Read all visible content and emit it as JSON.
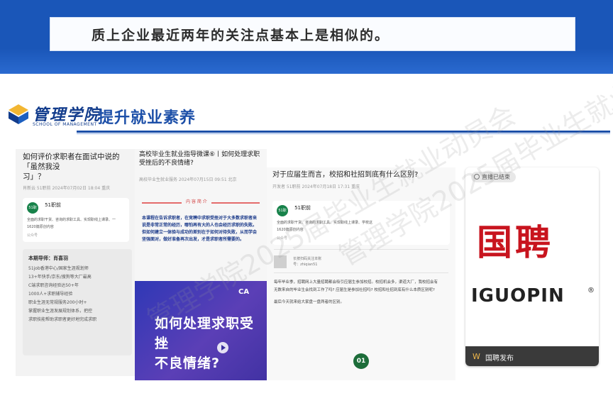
{
  "top_slide": {
    "caption": "质上企业最近两年的关注点基本上是相似的。"
  },
  "header": {
    "logo_text": "管理学院",
    "logo_sub": "SCHOOL OF MANAGEMENT",
    "title": "提升就业素养"
  },
  "panel1": {
    "title": "如何评价求职者在面试中说的「虽然我没",
    "title_cont": "习」？",
    "meta": "肖新云  51职前  2024年07月02日 18:04  重庆",
    "card_name": "51职前",
    "card_desc1": "全面的求职干货、咨询的求职工具、实现职线上课录、一",
    "card_desc2": "1620篇原创内容",
    "card_foot": "公众号",
    "intro_title": "本期导师：肖喜羽",
    "intro_lines": [
      "51job香港中心/国家生涯规划师",
      "13+年快手/京东/搜狗等大厂最高",
      "C端求职咨询经验达50+年",
      "1000人+求职辅导经验",
      "职业生涯无常规服务200小时+",
      "掌握职业生涯发展规划体系，把控",
      "求职技能帮助求职者更好地完成求职"
    ]
  },
  "panel2": {
    "title": "高校毕业生就业指导微课⑥丨如何处理求职受挫后的不良情绪?",
    "meta": "高校毕业生就业服务  2024年07月15日 09:51  北京",
    "promo_label": "内 容 简 介",
    "promo_text": "本课程在告诉求职者，在竞聘中求职受挫对于大多数求职者来说是非常正常的经历，哪怕再有大的人也会经历求职的失败。但如何建立一体验与成功的差别在于如何对待失败，从而学会坚强面对，做好准备再次出发，才是求职者所需要的。",
    "promo_caption_1": "如何处理求职受挫",
    "promo_caption_2": "不良情绪?",
    "promo_logo": "CA"
  },
  "panel3": {
    "title": "对于应届生而言，校招和社招到底有什么区别?",
    "meta": "开发者  51职前  2024年07月18日 17:31  重庆",
    "card_name": "51职前",
    "card_desc1": "全面的求职干货、咨询的求职工具、实现职线上课录、学校这",
    "card_desc2": "1620篇原创内容",
    "card_foot": "公众号",
    "qr_text_1": "长按扫码关注本账",
    "qr_text_2": "号：zhiqian51",
    "body_1": "每年毕业季，招聘网上大量招聘都会吸引应届生参加校招。校招机会多，渠道大厂，我校招会有",
    "body_2": "无数来自的毕业生会找到工作了吗? 应届生是参加社招吗? 校招和社招到底有什么本质区别呢?",
    "body_3": "最后今天就来给大家盘一盘两者的区别。",
    "badge": "01"
  },
  "panel4": {
    "live_label": "直播已结束",
    "brand_cn": "国聘",
    "brand_en": "IGUOPIN",
    "brand_reg": "®",
    "foot_text": "国聘发布"
  },
  "watermarks": [
    "管理学院2025届毕业生就业动员会"
  ]
}
